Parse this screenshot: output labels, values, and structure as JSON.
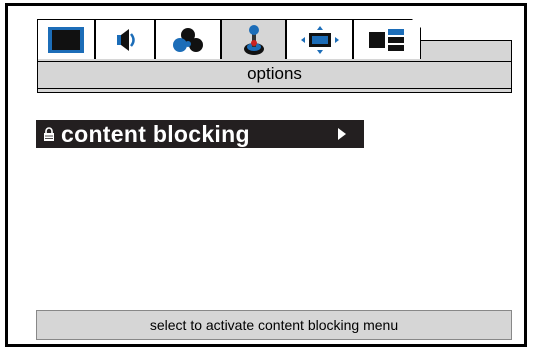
{
  "tabs": [
    {
      "icon": "screen-icon",
      "active": false
    },
    {
      "icon": "speaker-icon",
      "active": false
    },
    {
      "icon": "color-balls-icon",
      "active": false
    },
    {
      "icon": "joystick-icon",
      "active": true
    },
    {
      "icon": "aspect-arrows-icon",
      "active": false
    },
    {
      "icon": "pip-layout-icon",
      "active": false
    }
  ],
  "header": {
    "title": "options"
  },
  "menu": {
    "selected_item": {
      "label": "content blocking",
      "icon": "lock-icon",
      "submenu_icon": "arrow-right-icon"
    }
  },
  "status": {
    "text": "select to activate content blocking menu"
  },
  "colors": {
    "active_tab": "#d6d6d6",
    "highlight": "#231f20",
    "accent_blue": "#1c6db8"
  }
}
